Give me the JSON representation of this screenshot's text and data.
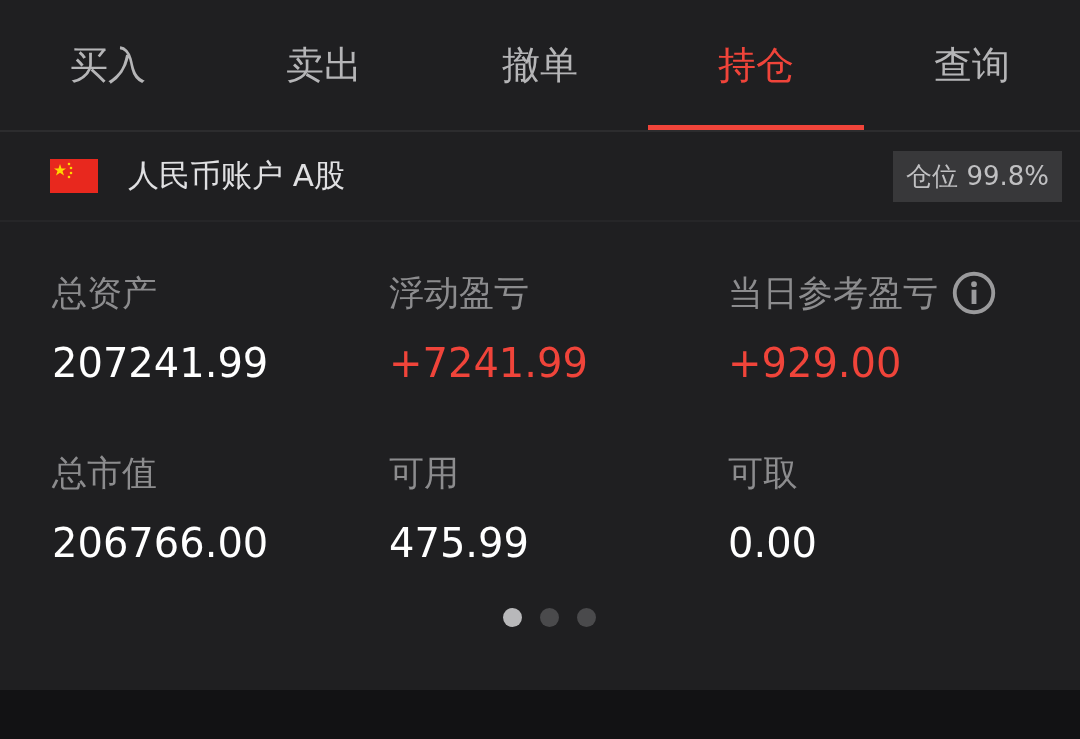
{
  "tabs": [
    {
      "label": "买入",
      "selected": false
    },
    {
      "label": "卖出",
      "selected": false
    },
    {
      "label": "撤单",
      "selected": false
    },
    {
      "label": "持仓",
      "selected": true
    },
    {
      "label": "查询",
      "selected": false
    }
  ],
  "account": {
    "name": "人民币账户 A股",
    "position": "仓位 99.8%"
  },
  "metrics": [
    {
      "label": "总资产",
      "value": "207241.99",
      "color": "#ffffff"
    },
    {
      "label": "浮动盈亏",
      "value": "+7241.99",
      "color": "#f0443a"
    },
    {
      "label": "当日参考盈亏",
      "value": "+929.00",
      "color": "#f0443a",
      "info": true
    },
    {
      "label": "总市值",
      "value": "206766.00",
      "color": "#ffffff"
    },
    {
      "label": "可用",
      "value": "475.99",
      "color": "#ffffff"
    },
    {
      "label": "可取",
      "value": "0.00",
      "color": "#ffffff"
    }
  ],
  "pager": [
    {
      "selected": true
    },
    {
      "selected": false
    },
    {
      "selected": false
    }
  ]
}
